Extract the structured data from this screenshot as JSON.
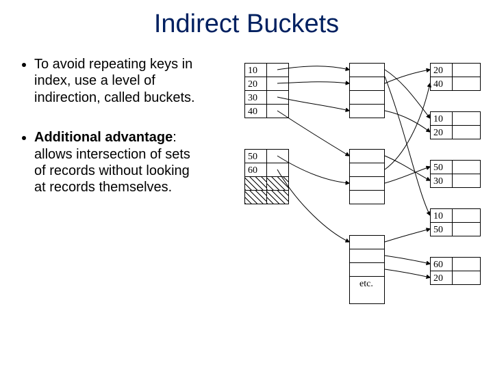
{
  "title": "Indirect Buckets",
  "bullets": {
    "item1": "To avoid repeating keys in index, use a level of indirection, called buckets.",
    "item2_prefix": "Additional advantage",
    "item2_rest": ": allows intersection of sets of records without looking at records themselves."
  },
  "diagram": {
    "index_block_a": [
      "10",
      "20",
      "30",
      "40"
    ],
    "index_block_b": [
      "50",
      "60"
    ],
    "records": {
      "r1": [
        "20",
        "40"
      ],
      "r2": [
        "10",
        "20"
      ],
      "r3": [
        "50",
        "30"
      ],
      "r4": [
        "10",
        "50"
      ],
      "r5": [
        "60",
        "20"
      ]
    },
    "etc_label": "etc."
  }
}
